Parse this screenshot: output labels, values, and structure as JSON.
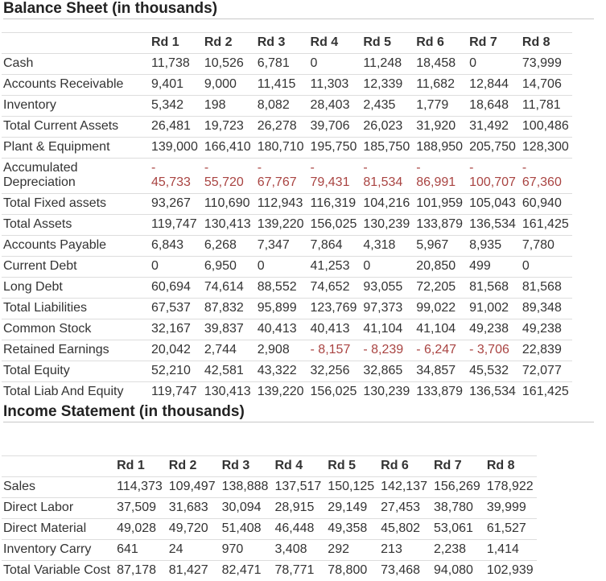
{
  "balance_sheet": {
    "title": "Balance Sheet (in thousands)",
    "columns": [
      "Rd 1",
      "Rd 2",
      "Rd 3",
      "Rd 4",
      "Rd 5",
      "Rd 6",
      "Rd 7",
      "Rd 8"
    ],
    "rows": [
      {
        "label": "Cash",
        "values": [
          "11,738",
          "10,526",
          "6,781",
          "0",
          "11,248",
          "18,458",
          "0",
          "73,999"
        ]
      },
      {
        "label": "Accounts Receivable",
        "values": [
          "9,401",
          "9,000",
          "11,415",
          "11,303",
          "12,339",
          "11,682",
          "12,844",
          "14,706"
        ]
      },
      {
        "label": "Inventory",
        "values": [
          "5,342",
          "198",
          "8,082",
          "28,403",
          "2,435",
          "1,779",
          "18,648",
          "11,781"
        ]
      },
      {
        "label": "Total Current Assets",
        "values": [
          "26,481",
          "19,723",
          "26,278",
          "39,706",
          "26,023",
          "31,920",
          "31,492",
          "100,486"
        ]
      },
      {
        "label": "Plant & Equipment",
        "values": [
          "139,000",
          "166,410",
          "180,710",
          "195,750",
          "185,750",
          "188,950",
          "205,750",
          "128,300"
        ]
      },
      {
        "label": "Accumulated Depreciation",
        "negative": true,
        "sign": "-",
        "values": [
          "45,733",
          "55,720",
          "67,767",
          "79,431",
          "81,534",
          "86,991",
          "100,707",
          "67,360"
        ]
      },
      {
        "label": "Total Fixed assets",
        "values": [
          "93,267",
          "110,690",
          "112,943",
          "116,319",
          "104,216",
          "101,959",
          "105,043",
          "60,940"
        ]
      },
      {
        "label": "Total Assets",
        "values": [
          "119,747",
          "130,413",
          "139,220",
          "156,025",
          "130,239",
          "133,879",
          "136,534",
          "161,425"
        ]
      },
      {
        "label": "Accounts Payable",
        "values": [
          "6,843",
          "6,268",
          "7,347",
          "7,864",
          "4,318",
          "5,967",
          "8,935",
          "7,780"
        ]
      },
      {
        "label": "Current Debt",
        "values": [
          "0",
          "6,950",
          "0",
          "41,253",
          "0",
          "20,850",
          "499",
          "0"
        ]
      },
      {
        "label": "Long Debt",
        "values": [
          "60,694",
          "74,614",
          "88,552",
          "74,652",
          "93,055",
          "72,205",
          "81,568",
          "81,568"
        ]
      },
      {
        "label": "Total Liabilities",
        "values": [
          "67,537",
          "87,832",
          "95,899",
          "123,769",
          "97,373",
          "99,022",
          "91,002",
          "89,348"
        ]
      },
      {
        "label": "Common Stock",
        "values": [
          "32,167",
          "39,837",
          "40,413",
          "40,413",
          "41,104",
          "41,104",
          "49,238",
          "49,238"
        ]
      },
      {
        "label": "Retained Earnings",
        "values": [
          "20,042",
          "2,744",
          "2,908",
          "- 8,157",
          "- 8,239",
          "- 6,247",
          "- 3,706",
          "22,839"
        ],
        "negative_cells": [
          3,
          4,
          5,
          6
        ]
      },
      {
        "label": "Total Equity",
        "values": [
          "52,210",
          "42,581",
          "43,322",
          "32,256",
          "32,865",
          "34,857",
          "45,532",
          "72,077"
        ]
      },
      {
        "label": "Total Liab And Equity",
        "values": [
          "119,747",
          "130,413",
          "139,220",
          "156,025",
          "130,239",
          "133,879",
          "136,534",
          "161,425"
        ]
      }
    ]
  },
  "income_statement": {
    "title": "Income Statement (in thousands)",
    "columns": [
      "Rd 1",
      "Rd 2",
      "Rd 3",
      "Rd 4",
      "Rd 5",
      "Rd 6",
      "Rd 7",
      "Rd 8"
    ],
    "rows": [
      {
        "label": "Sales",
        "values": [
          "114,373",
          "109,497",
          "138,888",
          "137,517",
          "150,125",
          "142,137",
          "156,269",
          "178,922"
        ]
      },
      {
        "label": "Direct Labor",
        "values": [
          "37,509",
          "31,683",
          "30,094",
          "28,915",
          "29,149",
          "27,453",
          "38,780",
          "39,999"
        ]
      },
      {
        "label": "Direct Material",
        "values": [
          "49,028",
          "49,720",
          "51,408",
          "46,448",
          "49,358",
          "45,802",
          "53,061",
          "61,527"
        ]
      },
      {
        "label": "Inventory Carry",
        "values": [
          "641",
          "24",
          "970",
          "3,408",
          "292",
          "213",
          "2,238",
          "1,414"
        ]
      },
      {
        "label": "Total Variable Cost",
        "values": [
          "87,178",
          "81,427",
          "82,471",
          "78,771",
          "78,800",
          "73,468",
          "94,080",
          "102,939"
        ]
      }
    ]
  },
  "colors": {
    "text": "#333333",
    "negative": "#a94442",
    "rule": "#dddddd"
  }
}
